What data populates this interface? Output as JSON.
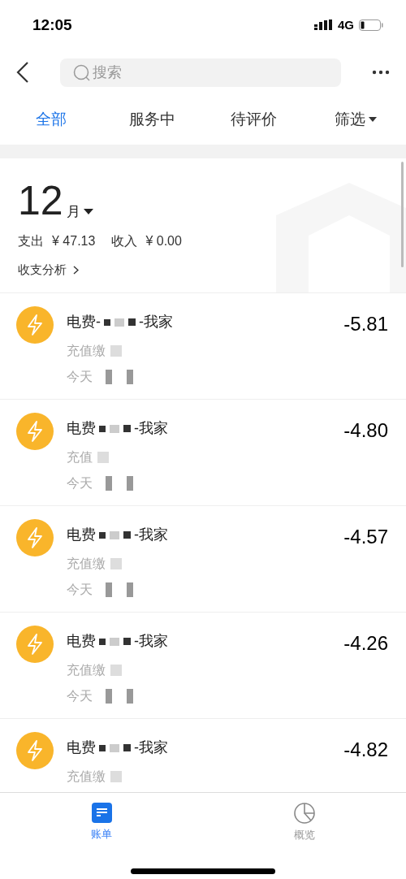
{
  "status_bar": {
    "time": "12:05",
    "network": "4G"
  },
  "header": {
    "search": {
      "placeholder": "搜索"
    }
  },
  "tabs": [
    {
      "label": "全部",
      "selected": true
    },
    {
      "label": "服务中",
      "selected": false
    },
    {
      "label": "待评价",
      "selected": false
    },
    {
      "label": "筛选",
      "selected": false,
      "kind": "dropdown"
    }
  ],
  "summary": {
    "month": "12",
    "month_unit": "月",
    "expense_label": "支出",
    "expense": "¥ 47.13",
    "income_label": "收入",
    "income": "¥ 0.00",
    "analysis_link": "收支分析"
  },
  "bills": [
    {
      "title_start": "电费-",
      "title_end": "-我家",
      "amount": "-5.81",
      "subtitle": "充值缴",
      "date": "今天"
    },
    {
      "title_start": "电费",
      "title_end": "-我家",
      "amount": "-4.80",
      "subtitle": "充值",
      "date": "今天"
    },
    {
      "title_start": "电费",
      "title_end": "-我家",
      "amount": "-4.57",
      "subtitle": "充值缴",
      "date": "今天"
    },
    {
      "title_start": "电费",
      "title_end": "-我家",
      "amount": "-4.26",
      "subtitle": "充值缴",
      "date": "今天"
    },
    {
      "title_start": "电费",
      "title_end": "-我家",
      "amount": "-4.82",
      "subtitle": "充值缴"
    }
  ],
  "bottom_nav": [
    {
      "label": "账单",
      "selected": true,
      "kind": "bill"
    },
    {
      "label": "概览",
      "selected": false,
      "kind": "overview"
    }
  ]
}
